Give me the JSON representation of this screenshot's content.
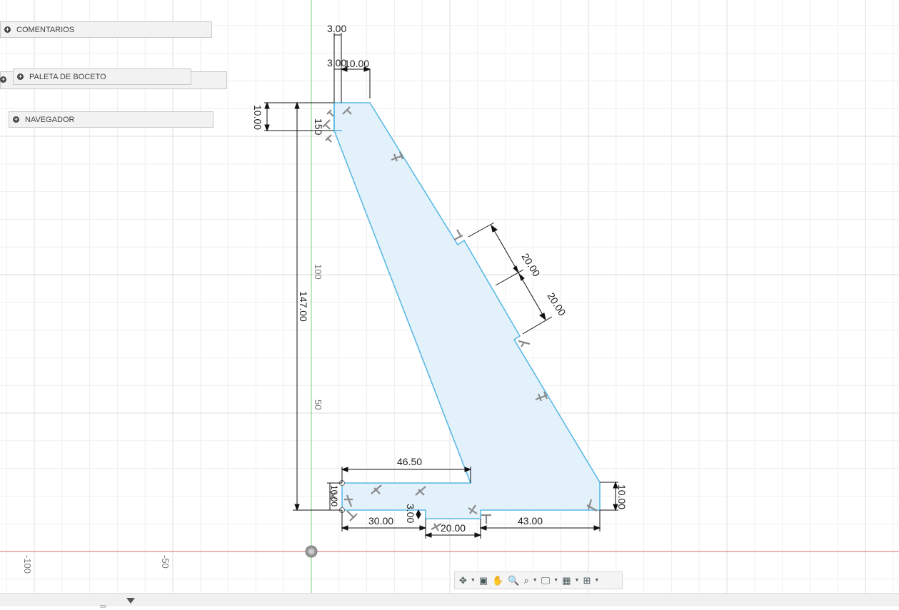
{
  "panels": {
    "comentarios": "COMENTARIOS",
    "paleta": "PALETA DE BOCETO",
    "navegador": "NAVEGADOR"
  },
  "axis_labels": {
    "y100": "100",
    "y50": "50",
    "x_neg100": "-100",
    "x_neg50": "-50"
  },
  "dimensions": {
    "d_3_top": "3.00",
    "d_3_second": "3.00",
    "d_10_top": "10.00",
    "d_10_left": "10.00",
    "d_150": "150",
    "d_147": "147.00",
    "d_20_slant_a": "20.00",
    "d_20_slant_b": "20.00",
    "d_46_50": "46.50",
    "d_10_right": "10.00",
    "d_30": "30.00",
    "d_3_bottom": "3.00",
    "d_20_bottom": "20.00",
    "d_43": "43.00",
    "d_10_bottom_left": "10.00"
  },
  "toolbar": {
    "orbit_icon": "orbit-icon",
    "look_at_icon": "look-at-icon",
    "pan_icon": "pan-icon",
    "zoom_icon": "zoom-icon",
    "fit_icon": "zoom-window-icon",
    "display_icon": "display-settings-icon",
    "grid_icon": "grid-icon",
    "viewports_icon": "viewports-icon"
  },
  "colors": {
    "sketch_line": "#5bb9e3",
    "sketch_fill": "#e3f1fa",
    "x_axis": "#e06a6a",
    "y_axis": "#7bd17b",
    "grid_major": "#dcdcdc",
    "grid_minor": "#efefef"
  }
}
